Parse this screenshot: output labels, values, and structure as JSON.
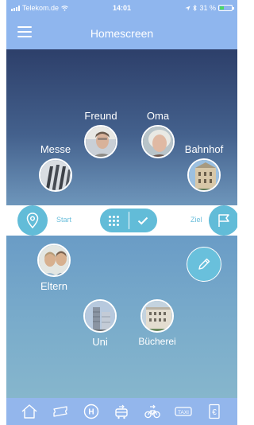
{
  "status_bar": {
    "carrier": "Telekom.de",
    "time": "14:01",
    "battery_percent": "31 %",
    "battery_level": 0.31,
    "icons": [
      "signal-icon",
      "wifi-icon",
      "location-icon",
      "bluetooth-icon",
      "battery-icon"
    ]
  },
  "nav": {
    "title": "Homescreen",
    "menu_icon": "hamburger-menu-icon"
  },
  "top_contacts": [
    {
      "label": "Freund",
      "icon": "person-photo"
    },
    {
      "label": "Oma",
      "icon": "person-photo"
    },
    {
      "label": "Messe",
      "icon": "building-photo"
    },
    {
      "label": "Bahnhof",
      "icon": "building-photo"
    }
  ],
  "route_bar": {
    "start_label": "Start",
    "ziel_label": "Ziel",
    "start_icon": "location-pin-icon",
    "ziel_icon": "flag-icon",
    "toggle_left_icon": "grid-dots-icon",
    "toggle_right_icon": "checkmark-icon"
  },
  "bottom_contacts": [
    {
      "label": "Eltern",
      "icon": "person-photo"
    },
    {
      "label": "Uni",
      "icon": "building-photo"
    },
    {
      "label": "Bücherei",
      "icon": "building-photo"
    }
  ],
  "edit_icon": "pencil-icon",
  "tabbar": {
    "icons": [
      "home-icon",
      "ticket-icon",
      "bus-stop-h-icon",
      "train-icon",
      "bike-icon",
      "taxi-icon",
      "euro-icon"
    ],
    "taxi_text": "TAXI",
    "h_text": "H",
    "euro_text": "€"
  },
  "colors": {
    "bar_blue": "#8fb6ee",
    "accent_cyan": "#62bcd8",
    "top_gradient_start": "#2d3f6a",
    "bottom_gradient_start": "#6a9cc6"
  }
}
